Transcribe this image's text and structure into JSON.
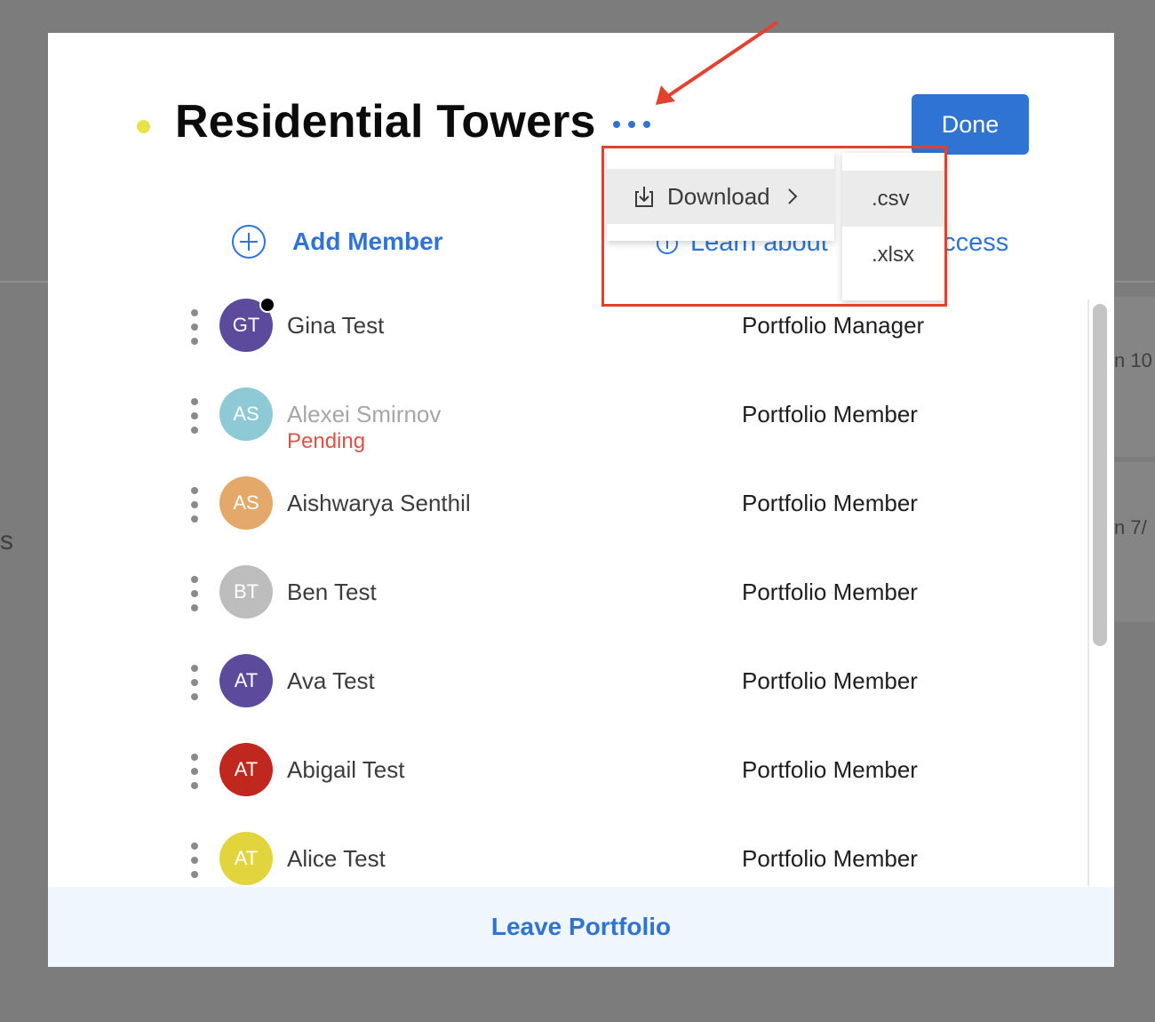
{
  "background": {
    "partial_texts": [
      "n 10",
      "n 7/",
      "s"
    ]
  },
  "modal": {
    "title": "Residential Towers",
    "done_label": "Done",
    "add_member_label": "Add Member",
    "learn_about_label": "Learn about",
    "access_label": "Access",
    "leave_label": "Leave Portfolio"
  },
  "menu": {
    "download_label": "Download",
    "formats": [
      ".csv",
      ".xlsx"
    ]
  },
  "members": [
    {
      "initials": "GT",
      "name": "Gina Test",
      "role": "Portfolio Manager",
      "color": "#5c4b9c",
      "online": true
    },
    {
      "initials": "AS",
      "name": "Alexei Smirnov",
      "role": "Portfolio Member",
      "color": "#8ec9d6",
      "status": "Pending"
    },
    {
      "initials": "AS",
      "name": "Aishwarya Senthil",
      "role": "Portfolio Member",
      "color": "#e5a86b"
    },
    {
      "initials": "BT",
      "name": "Ben Test",
      "role": "Portfolio Member",
      "color": "#bdbdbd"
    },
    {
      "initials": "AT",
      "name": "Ava Test",
      "role": "Portfolio Member",
      "color": "#5c4b9c"
    },
    {
      "initials": "AT",
      "name": "Abigail Test",
      "role": "Portfolio Member",
      "color": "#c0271f"
    },
    {
      "initials": "AT",
      "name": "Alice Test",
      "role": "Portfolio Member",
      "color": "#e2d43c"
    }
  ],
  "colors": {
    "accent": "#2f73d3",
    "annotation": "#e2412e",
    "pending": "#dc5247",
    "title_dot": "#e6e248"
  }
}
